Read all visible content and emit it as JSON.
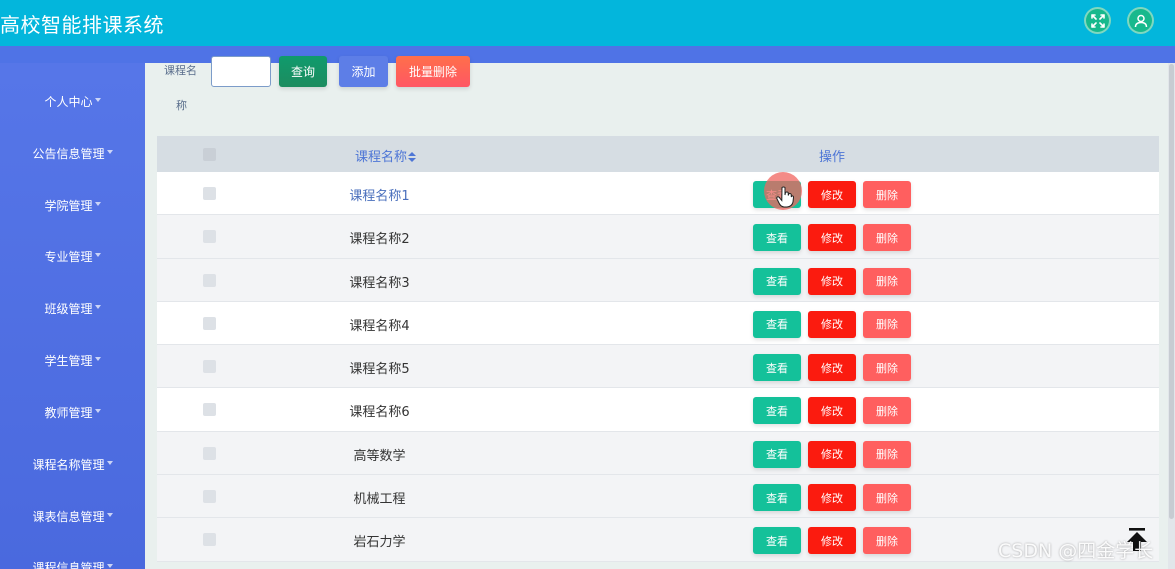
{
  "header": {
    "title": "高校智能排课系统",
    "icons": [
      "expand-icon",
      "user-icon"
    ],
    "color": "#03b6dc"
  },
  "sidebar": {
    "items": [
      {
        "label": "个人中心"
      },
      {
        "label": "公告信息管理"
      },
      {
        "label": "学院管理"
      },
      {
        "label": "专业管理"
      },
      {
        "label": "班级管理"
      },
      {
        "label": "学生管理"
      },
      {
        "label": "教师管理"
      },
      {
        "label": "课程名称管理"
      },
      {
        "label": "课表信息管理"
      },
      {
        "label": "课程信息管理"
      }
    ],
    "color": "#4f73e6"
  },
  "search": {
    "label_line1": "课程名",
    "label_line2": "称",
    "value": "",
    "query_label": "查询",
    "add_label": "添加",
    "batch_delete_label": "批量删除"
  },
  "table": {
    "headers": {
      "name": "课程名称",
      "ops": "操作"
    },
    "rows": [
      {
        "name": "课程名称1"
      },
      {
        "name": "课程名称2"
      },
      {
        "name": "课程名称3"
      },
      {
        "name": "课程名称4"
      },
      {
        "name": "课程名称5"
      },
      {
        "name": "课程名称6"
      },
      {
        "name": "高等数学"
      },
      {
        "name": "机械工程"
      },
      {
        "name": "岩石力学"
      }
    ],
    "actions": {
      "view": "查看",
      "edit": "修改",
      "delete": "删除"
    }
  },
  "watermark": "CSDN @四金学长",
  "colors": {
    "view": "#14c19a",
    "edit": "#fb1b0f",
    "delete": "#ff5f5f"
  }
}
